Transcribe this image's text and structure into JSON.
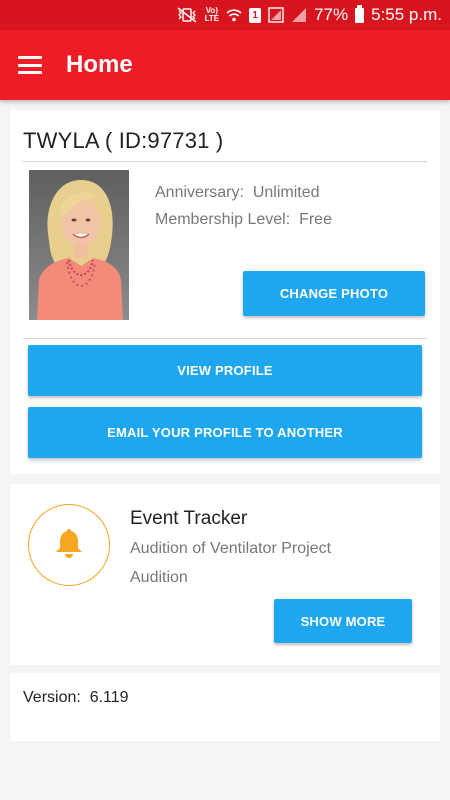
{
  "status_bar": {
    "lte_top": "Vo)",
    "lte_bottom": "LTE",
    "sim_number": "1",
    "battery": "77%",
    "time": "5:55 p.m."
  },
  "app_bar": {
    "title": "Home",
    "color": "#ee1c25"
  },
  "profile": {
    "title": "TWYLA ( ID:97731 )",
    "anniversary_label": "Anniversary:",
    "anniversary_value": "Unlimited",
    "membership_label": "Membership Level:",
    "membership_value": "Free",
    "change_photo_label": "CHANGE PHOTO",
    "view_profile_label": "VIEW PROFILE",
    "email_profile_label": "EMAIL YOUR PROFILE TO ANOTHER"
  },
  "event_tracker": {
    "title": "Event Tracker",
    "event_name": "Audition of Ventilator Project",
    "event_type": "Audition",
    "show_more_label": "SHOW MORE",
    "icon": "bell-icon",
    "icon_color": "#f5a623"
  },
  "version": {
    "label": "Version:",
    "value": "6.119"
  },
  "colors": {
    "button": "#1ea7ee",
    "status_bar": "#d8141f"
  }
}
